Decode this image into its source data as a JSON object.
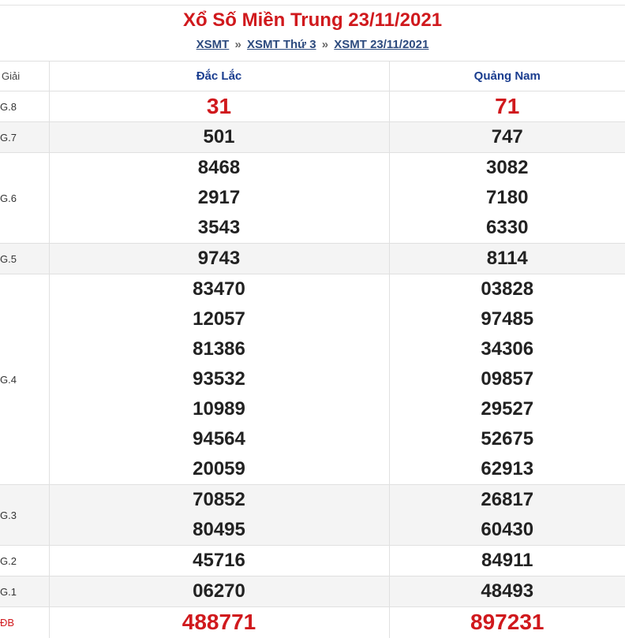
{
  "header": {
    "title": "Xổ Số Miền Trung 23/11/2021",
    "breadcrumb": {
      "item1": "XSMT",
      "sep": "»",
      "item2": "XSMT Thứ 3",
      "item3": "XSMT 23/11/2021"
    }
  },
  "table": {
    "col_giai": "Giải",
    "col_1": "Đắc Lắc",
    "col_2": "Quảng Nam",
    "rows": [
      {
        "label": "G.8",
        "a": [
          "31"
        ],
        "b": [
          "71"
        ]
      },
      {
        "label": "G.7",
        "a": [
          "501"
        ],
        "b": [
          "747"
        ]
      },
      {
        "label": "G.6",
        "a": [
          "8468",
          "2917",
          "3543"
        ],
        "b": [
          "3082",
          "7180",
          "6330"
        ]
      },
      {
        "label": "G.5",
        "a": [
          "9743"
        ],
        "b": [
          "8114"
        ]
      },
      {
        "label": "G.4",
        "a": [
          "83470",
          "12057",
          "81386",
          "93532",
          "10989",
          "94564",
          "20059"
        ],
        "b": [
          "03828",
          "97485",
          "34306",
          "09857",
          "29527",
          "52675",
          "62913"
        ]
      },
      {
        "label": "G.3",
        "a": [
          "70852",
          "80495"
        ],
        "b": [
          "26817",
          "60430"
        ]
      },
      {
        "label": "G.2",
        "a": [
          "45716"
        ],
        "b": [
          "84911"
        ]
      },
      {
        "label": "G.1",
        "a": [
          "06270"
        ],
        "b": [
          "48493"
        ]
      },
      {
        "label": "ĐB",
        "a": [
          "488771"
        ],
        "b": [
          "897231"
        ]
      }
    ]
  },
  "colors": {
    "accent_red": "#d0191d",
    "link_blue": "#2c4a7e",
    "header_blue": "#1a3d8f",
    "row_shade": "#f4f4f4"
  }
}
